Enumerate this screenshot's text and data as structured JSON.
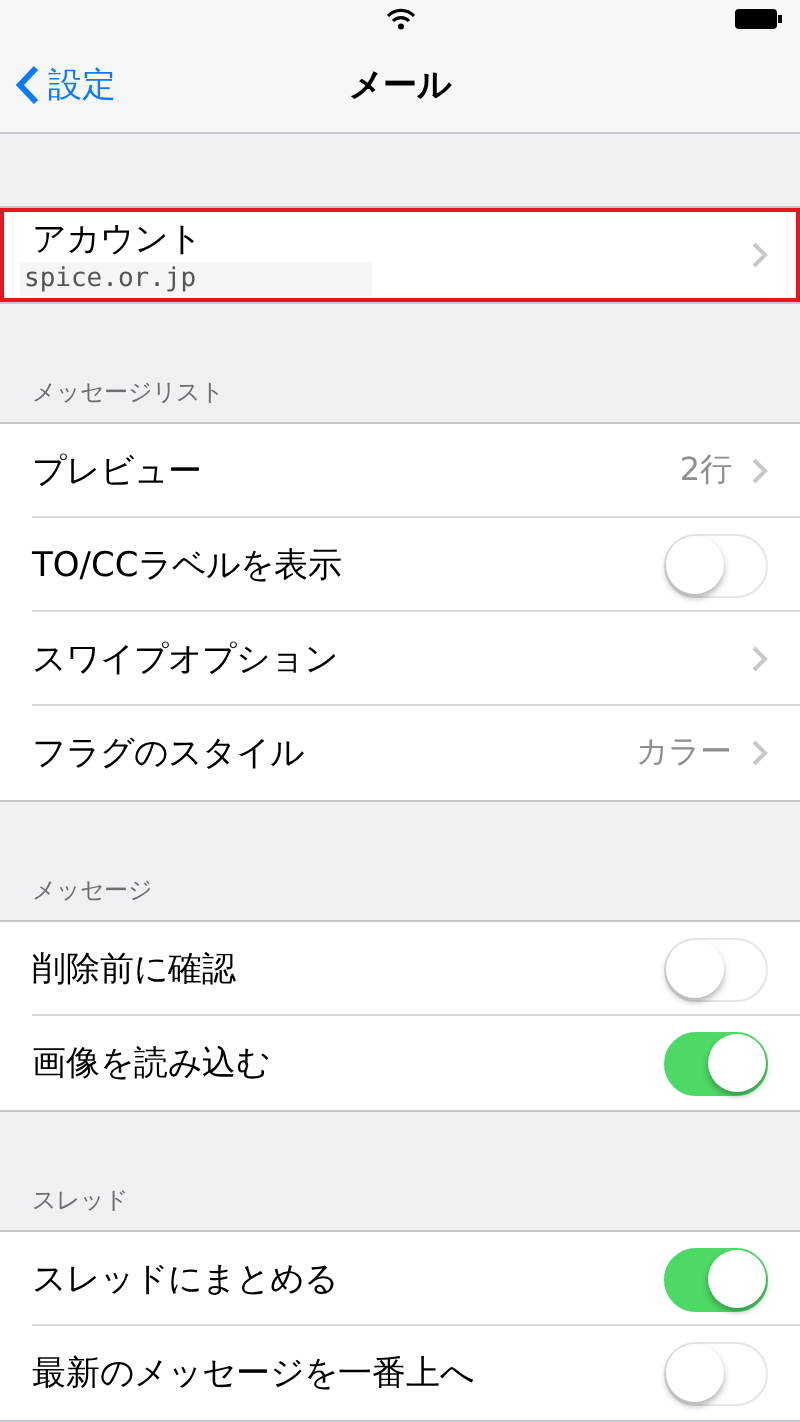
{
  "nav": {
    "back": "設定",
    "title": "メール"
  },
  "sections": [
    {
      "rows": [
        {
          "kind": "account",
          "label": "アカウント",
          "subtitle": "spice.or.jp",
          "highlighted": true
        }
      ]
    },
    {
      "header": "メッセージリスト",
      "rows": [
        {
          "kind": "link",
          "label": "プレビュー",
          "value": "2行"
        },
        {
          "kind": "toggle",
          "label": "TO/CCラベルを表示",
          "on": false
        },
        {
          "kind": "link",
          "label": "スワイプオプション"
        },
        {
          "kind": "link",
          "label": "フラグのスタイル",
          "value": "カラー"
        }
      ]
    },
    {
      "header": "メッセージ",
      "rows": [
        {
          "kind": "toggle",
          "label": "削除前に確認",
          "on": false
        },
        {
          "kind": "toggle",
          "label": "画像を読み込む",
          "on": true
        }
      ]
    },
    {
      "header": "スレッド",
      "rows": [
        {
          "kind": "toggle",
          "label": "スレッドにまとめる",
          "on": true
        },
        {
          "kind": "toggle",
          "label": "最新のメッセージを一番上へ",
          "on": false
        }
      ]
    }
  ]
}
